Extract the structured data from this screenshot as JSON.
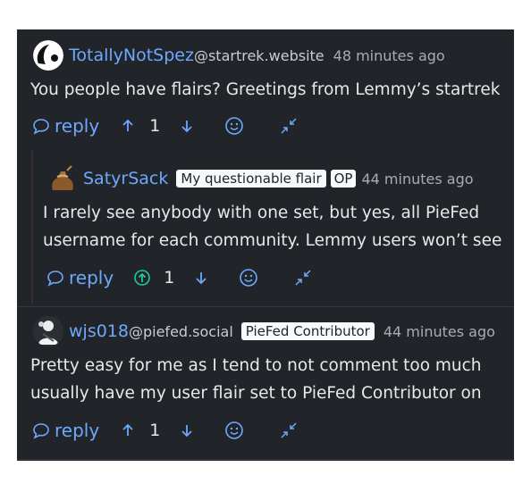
{
  "comments": [
    {
      "author": "TotallyNotSpez",
      "instance": "@startrek.website",
      "time": "48 minutes ago",
      "body": [
        "You people have flairs? Greetings from Lemmy’s startrek"
      ],
      "reply_label": "reply",
      "score": "1"
    },
    {
      "author": "SatyrSack",
      "flair": "My questionable flair",
      "op_badge": "OP",
      "time": "44 minutes ago",
      "body": [
        "I rarely see anybody with one set, but yes, all PieFed",
        "username for each community. Lemmy users won’t see"
      ],
      "reply_label": "reply",
      "score": "1",
      "upvoted": true
    },
    {
      "author": "wjs018",
      "instance": "@piefed.social",
      "flair": "PieFed Contributor",
      "time": "44 minutes ago",
      "body": [
        "Pretty easy for me as I tend to not comment too much",
        "usually have my user flair set to PieFed Contributor on"
      ],
      "reply_label": "reply",
      "score": "1"
    }
  ],
  "colors": {
    "link": "#6ea8fe",
    "background": "#212529",
    "upvoted": "#20c997"
  }
}
